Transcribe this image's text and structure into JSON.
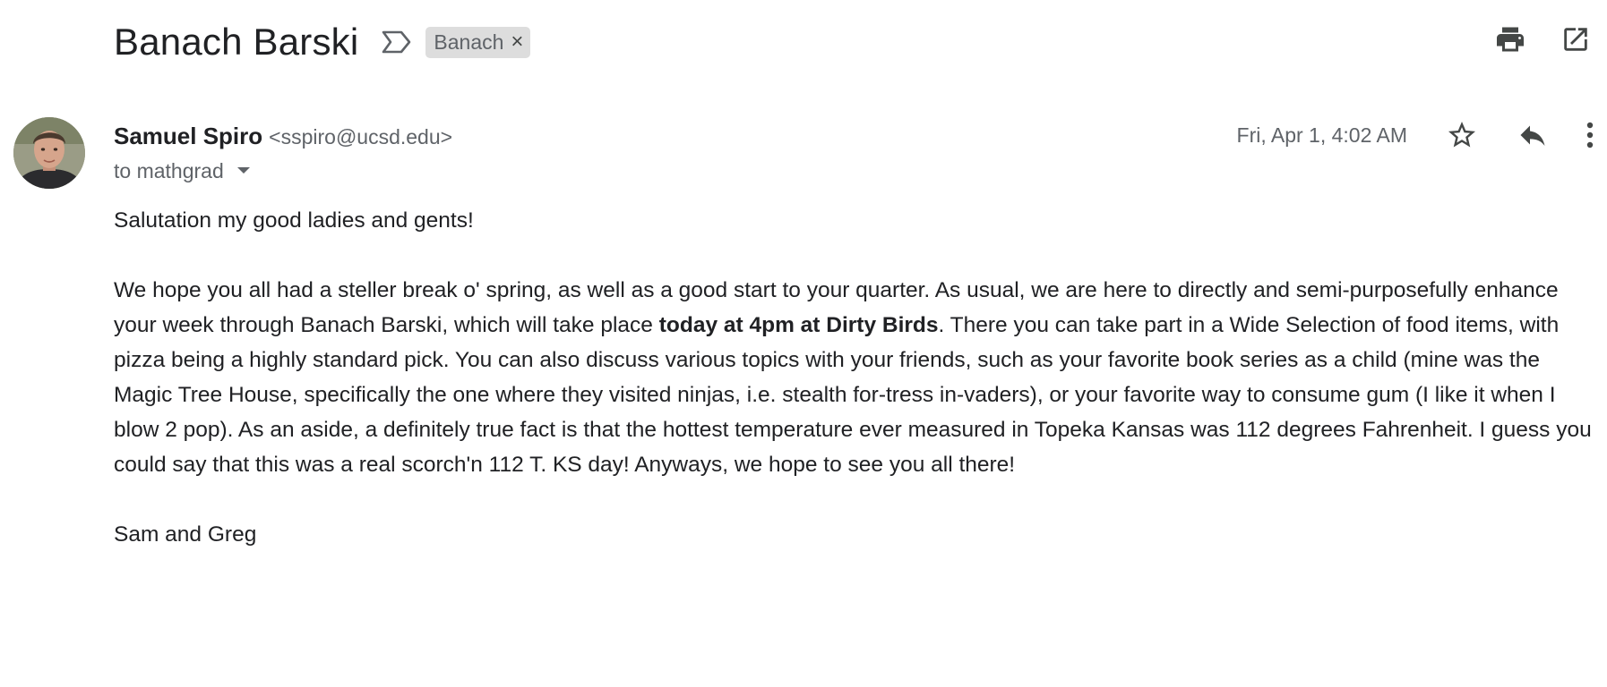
{
  "subject": "Banach Barski",
  "label_chip": {
    "text": "Banach",
    "close": "×"
  },
  "sender": {
    "name": "Samuel Spiro",
    "email": "<sspiro@ucsd.edu>"
  },
  "recipient": "to mathgrad",
  "timestamp": "Fri, Apr 1, 4:02 AM",
  "icons": {
    "important": "important-marker-icon",
    "print": "print-icon",
    "open_new_window": "open-in-new-window-icon",
    "star": "star-icon",
    "reply": "reply-icon",
    "more": "more-vert-icon",
    "dropdown": "chevron-down-icon"
  },
  "message": {
    "greeting": "Salutation my good ladies and gents!",
    "body_part1": "We hope you all had a steller break o' spring, as well as a good start to your quarter.  As usual, we are here to directly and semi-purposefully enhance your week through Banach Barski, which will take place ",
    "body_bold": "today at 4pm at Dirty Birds",
    "body_part2": ".  There you can take part in a Wide Selection of food items, with pizza being a highly standard pick.  You can also discuss various topics with your friends, such as your favorite book series as a child (mine was the Magic Tree House, specifically the one where they visited ninjas, i.e. stealth for-tress in-vaders), or your favorite way to consume gum (I like it when I blow 2 pop).  As an aside, a definitely true fact is that the hottest temperature ever measured in Topeka Kansas was 112 degrees Fahrenheit.  I guess you could say that this was a real scorch'n 112 T. KS day!  Anyways, we hope to see you all there!",
    "signoff": "Sam and Greg"
  },
  "colors": {
    "text_primary": "#202124",
    "text_secondary": "#5f6368",
    "chip_background": "#dddddd",
    "icon": "#444746"
  }
}
